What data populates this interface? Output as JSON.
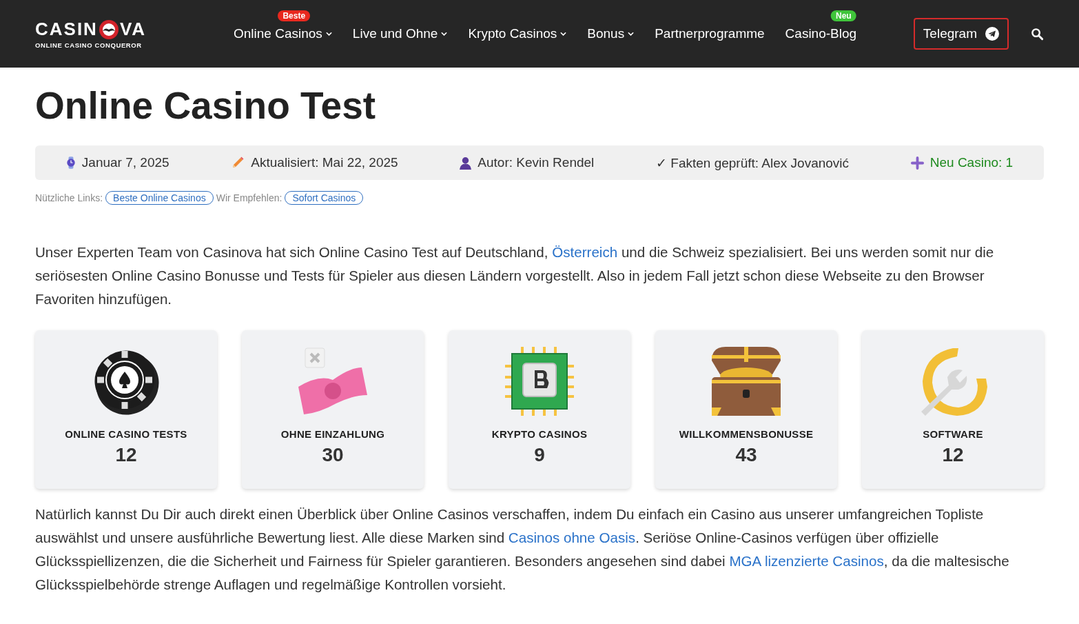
{
  "header": {
    "logo": {
      "left": "CASIN",
      "right": "VA",
      "tagline": "ONLINE CASINO CONQUEROR"
    },
    "nav": [
      {
        "label": "Online Casinos",
        "dropdown": true,
        "badge": {
          "text": "Beste",
          "color": "#e8281e"
        }
      },
      {
        "label": "Live und Ohne",
        "dropdown": true
      },
      {
        "label": "Krypto Casinos",
        "dropdown": true
      },
      {
        "label": "Bonus",
        "dropdown": true
      },
      {
        "label": "Partnerprogramme",
        "dropdown": false
      },
      {
        "label": "Casino-Blog",
        "dropdown": false,
        "badge": {
          "text": "Neu",
          "color": "#3fc43a"
        }
      }
    ],
    "telegram": "Telegram"
  },
  "title": "Online Casino Test",
  "meta": [
    {
      "kind": "date",
      "text": "Januar 7, 2025"
    },
    {
      "kind": "updated",
      "text": "Aktualisiert: Mai 22, 2025"
    },
    {
      "kind": "author",
      "text": "Autor: Kevin Rendel"
    },
    {
      "kind": "checked",
      "text": "✓ Fakten geprüft: Alex Jovanović"
    },
    {
      "kind": "new",
      "text": "Neu Casino: 1"
    }
  ],
  "useful_links": [
    {
      "kind": "label",
      "text": "Nützliche Links:"
    },
    {
      "kind": "link",
      "text": "Beste Online Casinos"
    },
    {
      "kind": "label",
      "text": "Wir Empfehlen:"
    },
    {
      "kind": "link",
      "text": "Sofort Casinos"
    }
  ],
  "intro": [
    {
      "kind": "text",
      "text": "Unser Experten Team von Casinova hat sich Online Casino Test auf Deutschland, "
    },
    {
      "kind": "link",
      "text": "Österreich"
    },
    {
      "kind": "text",
      "text": " und die Schweiz spezialisiert. Bei uns werden somit nur die seriösesten Online Casino Bonusse und Tests für Spieler aus diesen Ländern vorgestellt. Also in jedem Fall jetzt schon diese Webseite zu den Browser Favoriten hinzufügen."
    }
  ],
  "cards": [
    {
      "kind": "chip",
      "title": "ONLINE CASINO TESTS",
      "count": "12"
    },
    {
      "kind": "money",
      "title": "OHNE EINZAHLUNG",
      "count": "30"
    },
    {
      "kind": "bitcoin",
      "title": "KRYPTO CASINOS",
      "count": "9"
    },
    {
      "kind": "chest",
      "title": "WILLKOMMENSBONUSSE",
      "count": "43"
    },
    {
      "kind": "wrench",
      "title": "SOFTWARE",
      "count": "12"
    }
  ],
  "outro": [
    {
      "kind": "text",
      "text": "Natürlich kannst Du Dir auch direkt einen Überblick über Online Casinos verschaffen, indem Du einfach ein Casino aus unserer umfangreichen Topliste auswählst und unsere ausführliche Bewertung liest. Alle diese Marken sind "
    },
    {
      "kind": "link",
      "text": "Casinos ohne Oasis"
    },
    {
      "kind": "text",
      "text": ". Seriöse Online-Casinos verfügen über offizielle Glücksspiellizenzen, die die Sicherheit und Fairness für Spieler garantieren. Besonders angesehen sind dabei "
    },
    {
      "kind": "link",
      "text": "MGA lizenzierte Casinos"
    },
    {
      "kind": "text",
      "text": ", da die maltesische Glücksspielbehörde strenge Auflagen und regelmäßige Kontrollen vorsieht."
    }
  ]
}
